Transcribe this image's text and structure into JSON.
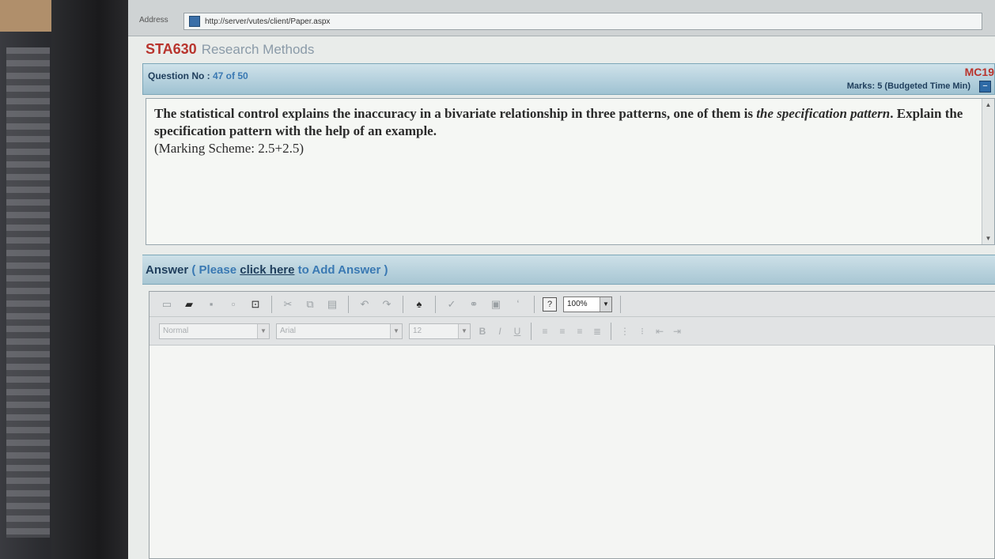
{
  "browser": {
    "address_label": "Address",
    "url": "http://server/vutes/client/Paper.aspx"
  },
  "course": {
    "code": "STA630",
    "name": "Research Methods"
  },
  "question": {
    "label": "Question No : ",
    "number": "47 of 50",
    "type_code": "MC19",
    "marks": "Marks: 5 (Budgeted Time Min)",
    "text_part1": "The statistical control explains the inaccuracy in a bivariate relationship in three patterns, one of them is ",
    "text_emphasis": "the specification pattern",
    "text_part2": ". Explain the specification pattern with the help of an example.",
    "marking_scheme": "(Marking Scheme: 2.5+2.5)"
  },
  "answer": {
    "label": "Answer",
    "open_paren": "(",
    "please": "Please",
    "link": "click here",
    "suffix": "to Add Answer",
    "close_paren": ")"
  },
  "editor": {
    "zoom": "100%",
    "paragraph_style": "Normal",
    "font_name": "Arial",
    "font_size": "12"
  },
  "colors": {
    "course_code": "#b8342d",
    "question_bar": "#9fc2d2",
    "link_blue": "#3a79b3"
  }
}
